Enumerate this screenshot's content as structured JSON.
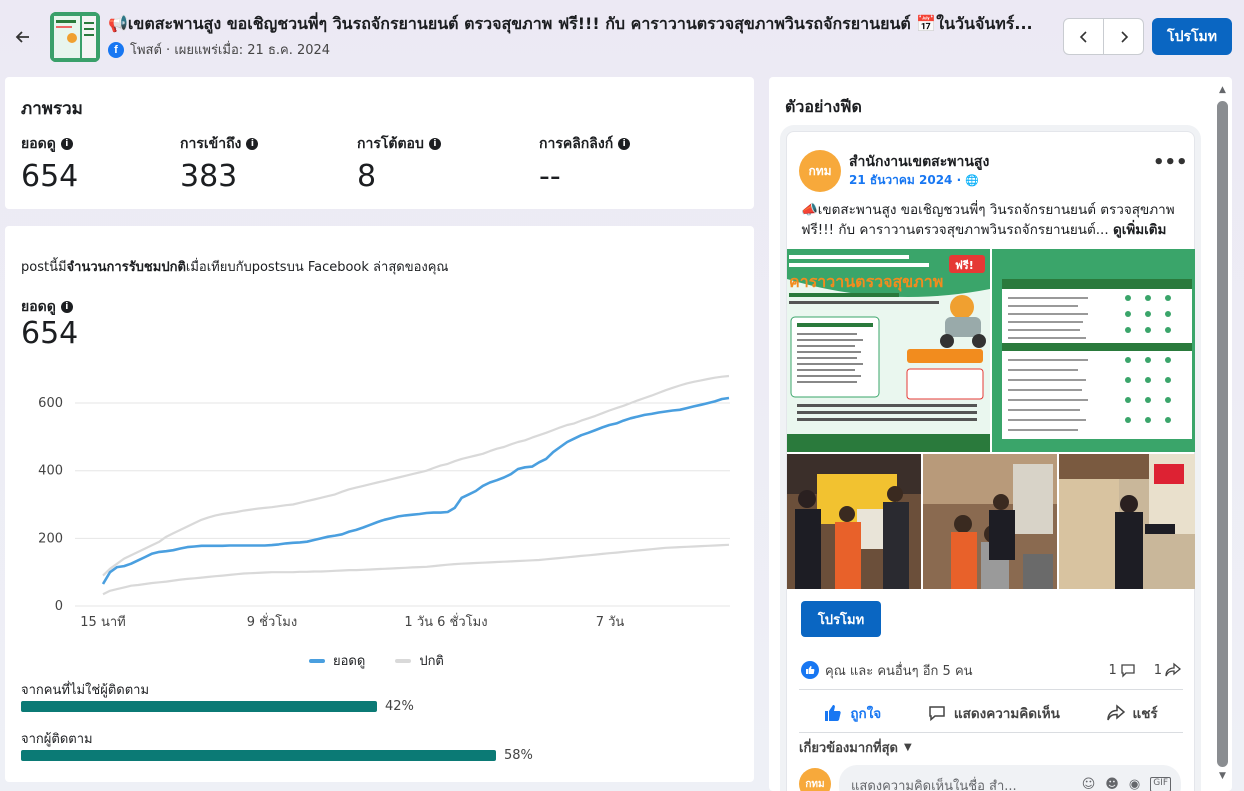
{
  "header": {
    "title": "📢เขตสะพานสูง ขอเชิญชวนพี่ๆ วินรถจักรยานยนต์ ตรวจสุขภาพ ฟรี!!! กับ คาราวานตรวจสุขภาพวินรถจักรยานยนต์ 📅ในวันจันทร์...",
    "subtitle": "โพสต์ · เผยแพร่เมื่อ: 21 ธ.ค. 2024",
    "back_icon": "arrow-left-icon",
    "prev_icon": "chevron-left-icon",
    "next_icon": "chevron-right-icon",
    "promote_label": "โปรโมท"
  },
  "overview": {
    "title": "ภาพรวม",
    "metrics": [
      {
        "label": "ยอดดู",
        "value": "654"
      },
      {
        "label": "การเข้าถึง",
        "value": "383"
      },
      {
        "label": "การโต้ตอบ",
        "value": "8"
      },
      {
        "label": "การคลิกลิงก์",
        "value": "--"
      }
    ]
  },
  "detail": {
    "compare_pre": "postนี้มี",
    "compare_bold": "จำนวนการรับชมปกติ",
    "compare_post": "เมื่อเทียบกับpostsบน Facebook ล่าสุดของคุณ",
    "views_label": "ยอดดู",
    "views_value": "654",
    "bars": [
      {
        "label": "จากคนที่ไม่ใช่ผู้ติดตาม",
        "percent": 42,
        "percent_label": "42%"
      },
      {
        "label": "จากผู้ติดตาม",
        "percent": 58,
        "percent_label": "58%"
      }
    ]
  },
  "chart_data": {
    "type": "line",
    "x_ticks": [
      "15 นาที",
      "9 ชั่วโมง",
      "1 วัน 6 ชั่วโมง",
      "7 วัน"
    ],
    "y_ticks": [
      0,
      200,
      400,
      600
    ],
    "ylim": [
      0,
      680
    ],
    "series": [
      {
        "name": "ยอดดู",
        "color": "#4a9fdf",
        "values": [
          65,
          100,
          115,
          118,
          125,
          135,
          145,
          155,
          160,
          162,
          165,
          170,
          174,
          176,
          178,
          178,
          178,
          178,
          179,
          179,
          179,
          179,
          179,
          179,
          180,
          182,
          185,
          187,
          188,
          190,
          195,
          200,
          205,
          208,
          212,
          220,
          225,
          232,
          240,
          248,
          255,
          260,
          265,
          268,
          270,
          272,
          275,
          276,
          276,
          278,
          290,
          320,
          330,
          340,
          355,
          365,
          372,
          380,
          390,
          405,
          410,
          412,
          425,
          435,
          455,
          470,
          485,
          495,
          505,
          512,
          520,
          528,
          535,
          540,
          548,
          555,
          560,
          565,
          568,
          572,
          575,
          578,
          580,
          585,
          590,
          595,
          600,
          605,
          612,
          615
        ]
      },
      {
        "name": "ปกติ",
        "color": "#d9d9d9",
        "values": [
          90,
          110,
          125,
          140,
          150,
          160,
          170,
          180,
          190,
          205,
          215,
          225,
          235,
          245,
          255,
          262,
          268,
          272,
          275,
          278,
          282,
          285,
          288,
          290,
          292,
          295,
          298,
          300,
          305,
          310,
          315,
          320,
          325,
          330,
          338,
          345,
          350,
          355,
          360,
          365,
          370,
          375,
          380,
          385,
          390,
          395,
          400,
          408,
          415,
          420,
          428,
          435,
          440,
          445,
          450,
          458,
          465,
          470,
          478,
          485,
          490,
          498,
          505,
          512,
          520,
          528,
          535,
          540,
          548,
          555,
          562,
          570,
          578,
          585,
          592,
          600,
          608,
          615,
          622,
          630,
          638,
          645,
          652,
          658,
          663,
          667,
          671,
          675,
          678,
          680
        ]
      },
      {
        "name": "ปกติ-low",
        "color": "#d9d9d9",
        "values": [
          35,
          45,
          50,
          55,
          60,
          62,
          65,
          68,
          70,
          72,
          75,
          78,
          80,
          82,
          84,
          86,
          88,
          90,
          92,
          94,
          96,
          97,
          98,
          99,
          100,
          100,
          100,
          100,
          101,
          101,
          102,
          102,
          103,
          104,
          105,
          106,
          106,
          107,
          108,
          109,
          110,
          111,
          112,
          113,
          114,
          115,
          116,
          118,
          120,
          122,
          124,
          125,
          126,
          127,
          128,
          129,
          130,
          131,
          132,
          133,
          134,
          135,
          136,
          138,
          140,
          142,
          144,
          146,
          148,
          150,
          152,
          154,
          156,
          158,
          160,
          162,
          164,
          166,
          168,
          170,
          172,
          173,
          174,
          175,
          176,
          177,
          178,
          179,
          180,
          181
        ]
      }
    ],
    "legend": [
      {
        "name": "ยอดดู",
        "color": "#4a9fdf"
      },
      {
        "name": "ปกติ",
        "color": "#d9d9d9"
      }
    ]
  },
  "preview": {
    "title": "ตัวอย่างฟีด",
    "page_avatar_text": "กทม",
    "page_name": "สำนักงานเขตสะพานสูง",
    "date": "21 ธันวาคม 2024 ·",
    "text": "📣เขตสะพานสูง ขอเชิญชวนพี่ๆ วินรถจักรยานยนต์ ตรวจสุขภาพ ฟรี!!! กับ คาราวานตรวจสุขภาพวินรถจักรยานยนต์...",
    "see_more": "ดูเพิ่มเติม",
    "promote_label": "โปรโมท",
    "reactions_text": "คุณ และ คนอื่นๆ อีก 5 คน",
    "comments_count": "1",
    "shares_count": "1",
    "like_label": "ถูกใจ",
    "comment_label": "แสดงความคิดเห็น",
    "share_label": "แชร์",
    "relevant_label": "เกี่ยวข้องมากที่สุด",
    "comment_placeholder": "แสดงความคิดเห็นในชื่อ สำ...",
    "poster_title": "คาราวานตรวจสุขภาพ",
    "poster_badge": "ฟรี!"
  }
}
